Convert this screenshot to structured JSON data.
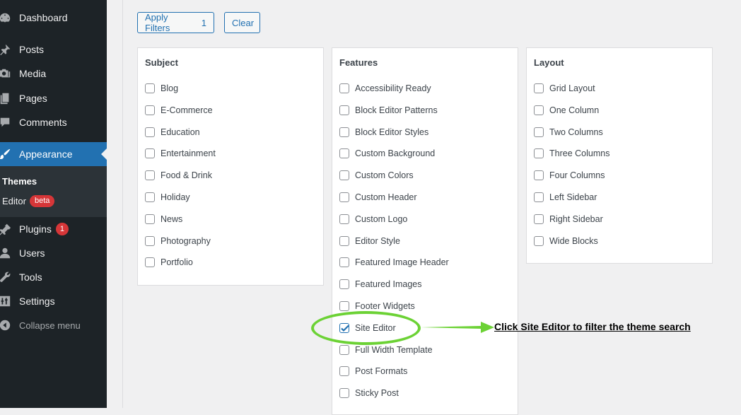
{
  "sidebar": {
    "items": {
      "dashboard": "Dashboard",
      "posts": "Posts",
      "media": "Media",
      "pages": "Pages",
      "comments": "Comments",
      "appearance": "Appearance",
      "plugins": "Plugins",
      "plugins_badge": "1",
      "users": "Users",
      "tools": "Tools",
      "settings": "Settings",
      "collapse": "Collapse menu"
    },
    "submenu": {
      "themes": "Themes",
      "editor": "Editor",
      "editor_badge": "beta"
    }
  },
  "toolbar": {
    "apply_label": "Apply Filters",
    "apply_count": "1",
    "clear_label": "Clear"
  },
  "filters": {
    "subject": {
      "title": "Subject",
      "options": [
        "Blog",
        "E-Commerce",
        "Education",
        "Entertainment",
        "Food & Drink",
        "Holiday",
        "News",
        "Photography",
        "Portfolio"
      ]
    },
    "features": {
      "title": "Features",
      "options": [
        "Accessibility Ready",
        "Block Editor Patterns",
        "Block Editor Styles",
        "Custom Background",
        "Custom Colors",
        "Custom Header",
        "Custom Logo",
        "Editor Style",
        "Featured Image Header",
        "Featured Images",
        "Footer Widgets",
        "Site Editor",
        "Full Width Template",
        "Post Formats",
        "Sticky Post"
      ],
      "checked": "Site Editor"
    },
    "layout": {
      "title": "Layout",
      "options": [
        "Grid Layout",
        "One Column",
        "Two Columns",
        "Three Columns",
        "Four Columns",
        "Left Sidebar",
        "Right Sidebar",
        "Wide Blocks"
      ]
    }
  },
  "annotation": {
    "text": "Click Site Editor to filter the theme search",
    "color": "#6cd235"
  },
  "colors": {
    "sidebar_bg": "#1d2327",
    "accent": "#2271b1",
    "badge": "#d63638"
  }
}
